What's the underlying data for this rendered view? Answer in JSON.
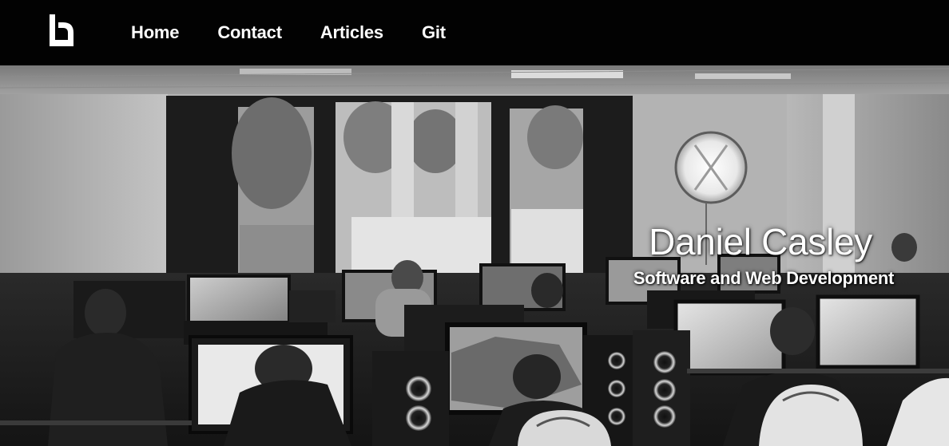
{
  "navbar": {
    "logo_icon": "dc-logo-icon",
    "links": [
      {
        "label": "Home"
      },
      {
        "label": "Contact"
      },
      {
        "label": "Articles"
      },
      {
        "label": "Git"
      }
    ]
  },
  "hero": {
    "title": "Daniel Casley",
    "subtitle": "Software and Web Development",
    "background_image": "grayscale-gaming-room-photo"
  },
  "colors": {
    "navbar_bg": "#020202",
    "text": "#ffffff"
  }
}
